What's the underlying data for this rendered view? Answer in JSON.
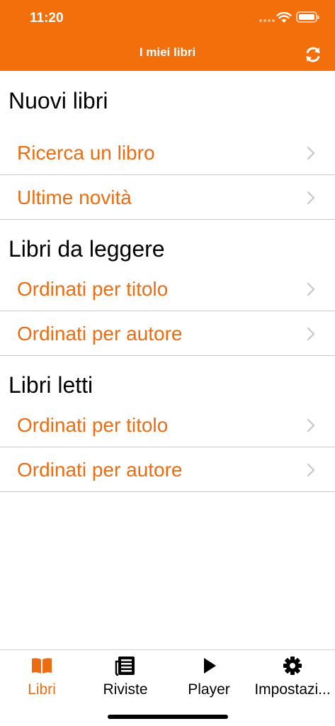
{
  "status_bar": {
    "time": "11:20",
    "icons": [
      "cellular-signal-icon",
      "wifi-icon",
      "battery-icon"
    ]
  },
  "nav": {
    "title": "I miei libri",
    "refresh_icon": "refresh-icon"
  },
  "sections": [
    {
      "title": "Nuovi libri",
      "items": [
        {
          "label": "Ricerca un libro"
        },
        {
          "label": "Ultime novità"
        }
      ]
    },
    {
      "title": "Libri da leggere",
      "items": [
        {
          "label": "Ordinati per titolo"
        },
        {
          "label": "Ordinati per autore"
        }
      ]
    },
    {
      "title": "Libri letti",
      "items": [
        {
          "label": "Ordinati per titolo"
        },
        {
          "label": "Ordinati per autore"
        }
      ]
    }
  ],
  "tabs": [
    {
      "label": "Libri",
      "icon": "book-icon",
      "active": true
    },
    {
      "label": "Riviste",
      "icon": "newspaper-icon",
      "active": false
    },
    {
      "label": "Player",
      "icon": "play-icon",
      "active": false
    },
    {
      "label": "Impostazi...",
      "icon": "gear-icon",
      "active": false
    }
  ],
  "colors": {
    "accent": "#f26f0b",
    "link_text": "#ec6c12",
    "separator": "#c8c7cc",
    "chevron": "#c7c7cc"
  }
}
